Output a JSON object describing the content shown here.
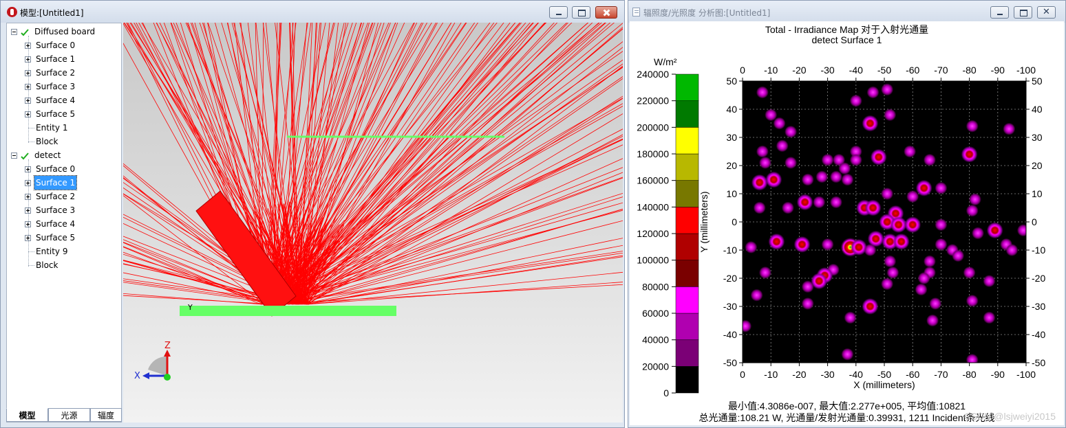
{
  "left_window": {
    "title": "模型:[Untitled1]",
    "tree": [
      {
        "label": "Diffused board",
        "checked": true,
        "expanded": true
      },
      {
        "label": "Surface 0"
      },
      {
        "label": "Surface 1"
      },
      {
        "label": "Surface 2"
      },
      {
        "label": "Surface 3"
      },
      {
        "label": "Surface 4"
      },
      {
        "label": "Surface 5"
      },
      {
        "label": "Entity 1"
      },
      {
        "label": "Block"
      },
      {
        "label": "detect",
        "checked": true,
        "expanded": true
      },
      {
        "label": "Surface 0"
      },
      {
        "label": "Surface 1",
        "selected": true
      },
      {
        "label": "Surface 2"
      },
      {
        "label": "Surface 3"
      },
      {
        "label": "Surface 4"
      },
      {
        "label": "Surface 5"
      },
      {
        "label": "Entity 9"
      },
      {
        "label": "Block"
      }
    ],
    "tabs": [
      "模型",
      "光源",
      "辐度"
    ],
    "viewport": {
      "ray_color": "#ff0000",
      "element_color": "#66ff66",
      "source_label": "Y",
      "axes": {
        "z": "Z",
        "x": "X"
      }
    }
  },
  "right_window": {
    "title": "辐照度/光照度 分析图:[Untitled1]",
    "chart_title_line1": "Total - Irradiance Map 对于入射光通量",
    "chart_title_line2": "detect Surface 1",
    "footer_line1": "最小值:4.3086e-007, 最大值:2.277e+005, 平均值:10821",
    "footer_line2": "总光通量:108.21 W, 光通量/发射光通量:0.39931, 1211 Incident条光线",
    "watermark": "CSDN @lsjweiyi2015"
  },
  "chart_data": {
    "type": "heatmap",
    "title": "Total - Irradiance Map 对于入射光通量",
    "subtitle": "detect Surface 1",
    "xlabel": "X (millimeters)",
    "ylabel": "Y (millimeters)",
    "x_ticks": [
      "0",
      "-10",
      "-20",
      "-30",
      "-40",
      "-50",
      "-60",
      "-70",
      "-80",
      "-90",
      "-100"
    ],
    "y_ticks": [
      "50",
      "40",
      "30",
      "20",
      "10",
      "0",
      "-10",
      "-20",
      "-30",
      "-40",
      "-50"
    ],
    "xlim": [
      0,
      -100
    ],
    "ylim": [
      -50,
      50
    ],
    "grid": true,
    "colorbar": {
      "unit": "W/m²",
      "levels": [
        0,
        20000,
        40000,
        60000,
        80000,
        100000,
        120000,
        140000,
        160000,
        180000,
        200000,
        220000,
        240000
      ],
      "labels": [
        "0",
        "20000",
        "40000",
        "60000",
        "80000",
        "100000",
        "120000",
        "140000",
        "160000",
        "180000",
        "200000",
        "220000",
        "240000"
      ],
      "colors": [
        "#000000",
        "#7b0076",
        "#b000b0",
        "#ff00ff",
        "#7a0000",
        "#b00000",
        "#ff0000",
        "#787800",
        "#b8b800",
        "#ffff00",
        "#007a00",
        "#00b800"
      ]
    },
    "stats": {
      "min": "4.3086e-007",
      "max": "2.277e+005",
      "mean": "10821"
    },
    "hot_spots": [
      {
        "x": -7,
        "y": 46
      },
      {
        "x": -46,
        "y": 46
      },
      {
        "x": -51,
        "y": 47
      },
      {
        "x": -40,
        "y": 43
      },
      {
        "x": -10,
        "y": 38
      },
      {
        "x": -13,
        "y": 35
      },
      {
        "x": -17,
        "y": 32
      },
      {
        "x": -52,
        "y": 38
      },
      {
        "x": -45,
        "y": 35,
        "v": 120000
      },
      {
        "x": -81,
        "y": 34
      },
      {
        "x": -94,
        "y": 33
      },
      {
        "x": -14,
        "y": 27
      },
      {
        "x": -7,
        "y": 25
      },
      {
        "x": -8,
        "y": 21
      },
      {
        "x": -17,
        "y": 21
      },
      {
        "x": -30,
        "y": 22
      },
      {
        "x": -34,
        "y": 22
      },
      {
        "x": -40,
        "y": 25
      },
      {
        "x": -48,
        "y": 23,
        "v": 130000
      },
      {
        "x": -59,
        "y": 25
      },
      {
        "x": -66,
        "y": 22
      },
      {
        "x": -80,
        "y": 24,
        "v": 110000
      },
      {
        "x": -36,
        "y": 19
      },
      {
        "x": -40,
        "y": 22
      },
      {
        "x": -28,
        "y": 16
      },
      {
        "x": -23,
        "y": 15
      },
      {
        "x": -33,
        "y": 16
      },
      {
        "x": -37,
        "y": 15
      },
      {
        "x": -6,
        "y": 14,
        "v": 110000
      },
      {
        "x": -11,
        "y": 15,
        "v": 110000
      },
      {
        "x": -64,
        "y": 12,
        "v": 100000
      },
      {
        "x": -70,
        "y": 12
      },
      {
        "x": -51,
        "y": 10
      },
      {
        "x": -60,
        "y": 9
      },
      {
        "x": -22,
        "y": 7,
        "v": 100000
      },
      {
        "x": -27,
        "y": 7
      },
      {
        "x": -33,
        "y": 7
      },
      {
        "x": -6,
        "y": 5
      },
      {
        "x": -16,
        "y": 5
      },
      {
        "x": -43,
        "y": 5,
        "v": 120000
      },
      {
        "x": -46,
        "y": 5,
        "v": 130000
      },
      {
        "x": -54,
        "y": 3,
        "v": 110000
      },
      {
        "x": -82,
        "y": 8
      },
      {
        "x": -81,
        "y": 4
      },
      {
        "x": -51,
        "y": 0,
        "v": 110000
      },
      {
        "x": -55,
        "y": -1,
        "v": 110000
      },
      {
        "x": -60,
        "y": -1,
        "v": 100000
      },
      {
        "x": -70,
        "y": -1
      },
      {
        "x": -83,
        "y": -4
      },
      {
        "x": -89,
        "y": -3,
        "v": 100000
      },
      {
        "x": -99,
        "y": -3
      },
      {
        "x": -12,
        "y": -7,
        "v": 110000
      },
      {
        "x": -21,
        "y": -8,
        "v": 100000
      },
      {
        "x": -30,
        "y": -8
      },
      {
        "x": -38,
        "y": -9,
        "v": 227700
      },
      {
        "x": -41,
        "y": -9,
        "v": 120000
      },
      {
        "x": -47,
        "y": -6,
        "v": 120000
      },
      {
        "x": -52,
        "y": -7,
        "v": 110000
      },
      {
        "x": -56,
        "y": -7,
        "v": 110000
      },
      {
        "x": -45,
        "y": -10
      },
      {
        "x": -70,
        "y": -8
      },
      {
        "x": -74,
        "y": -10
      },
      {
        "x": -93,
        "y": -8
      },
      {
        "x": -95,
        "y": -10
      },
      {
        "x": -3,
        "y": -9
      },
      {
        "x": -52,
        "y": -14
      },
      {
        "x": -66,
        "y": -14
      },
      {
        "x": -76,
        "y": -12
      },
      {
        "x": -8,
        "y": -18
      },
      {
        "x": -32,
        "y": -17
      },
      {
        "x": -29,
        "y": -19,
        "v": 100000
      },
      {
        "x": -27,
        "y": -21,
        "v": 100000
      },
      {
        "x": -53,
        "y": -18
      },
      {
        "x": -51,
        "y": -22
      },
      {
        "x": -66,
        "y": -18
      },
      {
        "x": -64,
        "y": -20
      },
      {
        "x": -80,
        "y": -18
      },
      {
        "x": -87,
        "y": -21
      },
      {
        "x": -23,
        "y": -23
      },
      {
        "x": -63,
        "y": -24
      },
      {
        "x": -5,
        "y": -26
      },
      {
        "x": -23,
        "y": -29
      },
      {
        "x": -45,
        "y": -30,
        "v": 110000
      },
      {
        "x": -68,
        "y": -29
      },
      {
        "x": -81,
        "y": -28
      },
      {
        "x": -67,
        "y": -35
      },
      {
        "x": -38,
        "y": -34
      },
      {
        "x": -87,
        "y": -34
      },
      {
        "x": -1,
        "y": -37
      },
      {
        "x": -37,
        "y": -47
      },
      {
        "x": -81,
        "y": -49
      }
    ]
  }
}
